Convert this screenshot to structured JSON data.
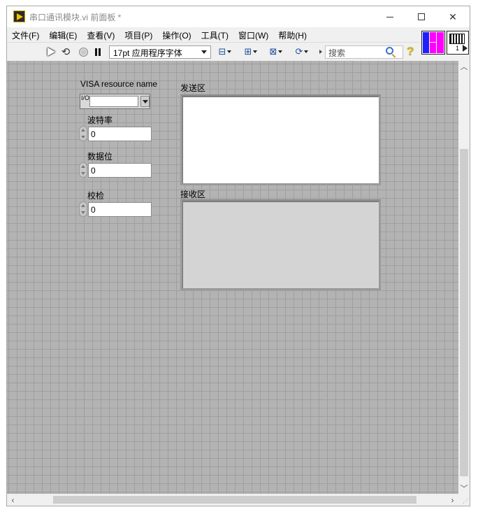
{
  "window": {
    "title": "串口通讯模块.vi 前面板 *"
  },
  "menu": {
    "items": [
      "文件(F)",
      "编辑(E)",
      "查看(V)",
      "项目(P)",
      "操作(O)",
      "工具(T)",
      "窗口(W)",
      "帮助(H)"
    ]
  },
  "toolbar": {
    "font_select": "17pt 应用程序字体",
    "search_placeholder": "搜索",
    "help_glyph": "?"
  },
  "icons": {
    "vi_icon_number": "1"
  },
  "panel": {
    "visa_label": "VISA resource name",
    "visa_io_glyph": "I/O",
    "visa_value": "",
    "baud_label": "波特率",
    "baud_value": "0",
    "databits_label": "数据位",
    "databits_value": "0",
    "parity_label": "校检",
    "parity_value": "0",
    "send_label": "发送区",
    "send_text": "",
    "recv_label": "接收区",
    "recv_text": ""
  },
  "colors": {
    "panel_bg": "#b3b3b3",
    "grid": "#9f9f9f",
    "connector_blue": "#2020ff",
    "connector_magenta": "#ff00ff"
  }
}
